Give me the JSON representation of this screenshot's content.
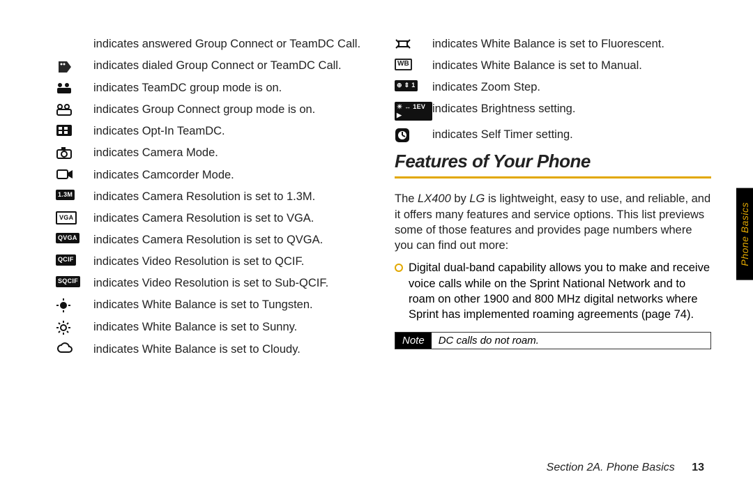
{
  "side_tab": "Phone Basics",
  "footer": {
    "section": "Section 2A. Phone Basics",
    "page": "13"
  },
  "heading": "Features of Your Phone",
  "intro": {
    "pre": "The ",
    "product": "LX400",
    "mid": " by ",
    "brand": "LG",
    "post": " is lightweight, easy to use, and reliable, and it offers many features and service options. This list previews some of those features and provides page numbers where you can find out more:"
  },
  "bullet": "Digital dual-band capability allows you to make and receive voice calls while on the Sprint National Network and to roam on other 1900 and 800 MHz digital networks where Sprint has implemented roaming agreements (page 74).",
  "note": {
    "label": "Note",
    "body": "DC calls do not roam."
  },
  "left_rows": [
    {
      "id": "answered-groupcall",
      "icon_svg": "",
      "text": "indicates answered Group Connect or TeamDC Call."
    },
    {
      "id": "dialed-groupcall",
      "icon_svg": "<svg width='26' height='22'><g fill='#111'><path d='M4 4 h12 l6 8 -6 8 h-12 z' opacity='0.9'/><circle cx='8' cy='8' r='1.5' fill='#fff'/><circle cx='12' cy='8' r='1.5' fill='#fff'/></g></svg>",
      "text": "indicates dialed Group Connect or TeamDC Call."
    },
    {
      "id": "teamdc-group-on",
      "icon_svg": "<svg width='24' height='20'><g fill='#111'><circle cx='6' cy='6' r='3'/><circle cx='16' cy='6' r='3'/><rect x='2' y='10' width='20' height='8' rx='2'/></g></svg>",
      "text": "indicates TeamDC group mode is on."
    },
    {
      "id": "groupconnect-on",
      "icon_svg": "<svg width='24' height='20'><g fill='none' stroke='#111' stroke-width='2'><circle cx='6' cy='6' r='3'/><circle cx='16' cy='6' r='3'/><rect x='2' y='10' width='20' height='8' rx='2'/></g></svg>",
      "text": "indicates Group Connect group mode is on."
    },
    {
      "id": "optin-teamdc",
      "icon_svg": "<svg width='24' height='18'><rect x='1' y='1' width='22' height='16' rx='2' fill='#111'/><rect x='4' y='4' width='5' height='4' fill='#fff'/><rect x='12' y='4' width='5' height='4' fill='#fff'/><rect x='4' y='10' width='5' height='4' fill='#fff'/><rect x='12' y='10' width='5' height='4' fill='#fff'/></svg>",
      "text": "indicates Opt-In TeamDC."
    },
    {
      "id": "camera-mode",
      "icon_svg": "<svg width='24' height='20'><rect x='2' y='6' width='20' height='12' rx='2' fill='none' stroke='#111' stroke-width='2'/><circle cx='12' cy='12' r='4' fill='none' stroke='#111' stroke-width='2'/><rect x='8' y='2' width='6' height='4' fill='#111'/></svg>",
      "text": "indicates Camera Mode."
    },
    {
      "id": "camcorder-mode",
      "icon_svg": "<svg width='26' height='18'><rect x='2' y='3' width='15' height='12' rx='2' fill='none' stroke='#111' stroke-width='2'/><path d='M17 7 l7 -4 v12 l-7 -4 z' fill='#111'/></svg>",
      "text": "indicates Camcorder Mode."
    },
    {
      "id": "res-1-3m",
      "icon_svg": "<span class='box-icon'>1.3M</span>",
      "text": "indicates Camera Resolution is set to 1.3M."
    },
    {
      "id": "res-vga",
      "icon_svg": "<span class='box-icon' style='background:#fff;color:#111;border:2px solid #111'>VGA</span>",
      "text": "indicates Camera Resolution is set to VGA."
    },
    {
      "id": "res-qvga",
      "icon_svg": "<span class='box-icon'>QVGA</span>",
      "text": "indicates Camera Resolution is set to QVGA."
    },
    {
      "id": "vidres-qcif",
      "icon_svg": "<span class='box-icon'>QCIF</span>",
      "text": "indicates Video Resolution is set to QCIF."
    },
    {
      "id": "vidres-subqcif",
      "icon_svg": "<span class='box-icon'>SQCIF</span>",
      "text": "indicates Video Resolution is set to Sub-QCIF."
    },
    {
      "id": "wb-tungsten",
      "icon_svg": "<svg width='22' height='22'><g fill='#111'><circle cx='11' cy='11' r='5'/><g stroke='#111' stroke-width='2'><line x1='11' y1='1' x2='11' y2='4'/><line x1='11' y1='18' x2='11' y2='21'/><line x1='1' y1='11' x2='4' y2='11'/><line x1='18' y1='11' x2='21' y2='11'/></g></g></svg>",
      "text": "indicates White Balance is set to Tungsten."
    },
    {
      "id": "wb-sunny",
      "icon_svg": "<svg width='22' height='22'><g fill='none' stroke='#111' stroke-width='2'><circle cx='11' cy='11' r='4'/><line x1='11' y1='1' x2='11' y2='4'/><line x1='11' y1='18' x2='11' y2='21'/><line x1='1' y1='11' x2='4' y2='11'/><line x1='18' y1='11' x2='21' y2='11'/><line x1='4' y1='4' x2='6' y2='6'/><line x1='16' y1='16' x2='18' y2='18'/><line x1='16' y1='6' x2='18' y2='4'/><line x1='4' y1='18' x2='6' y2='16'/></g></svg>",
      "text": "indicates White Balance is set to Sunny."
    },
    {
      "id": "wb-cloudy",
      "icon_svg": "<svg width='26' height='18'><path d='M8 14 a5 5 0 0 1 0 -10 a6 6 0 0 1 11 2 a4 4 0 0 1 0 8 z' fill='none' stroke='#111' stroke-width='2'/></svg>",
      "text": "indicates White Balance is set to Cloudy."
    }
  ],
  "right_rows": [
    {
      "id": "wb-fluorescent",
      "icon_svg": "<svg width='24' height='20'><g stroke='#111' stroke-width='2'><rect x='6' y='6' width='12' height='8' fill='none'/><line x1='2' y1='4' x2='6' y2='8'/><line x1='22' y1='4' x2='18' y2='8'/><line x1='2' y1='16' x2='6' y2='12'/><line x1='22' y1='16' x2='18' y2='12'/></g></svg>",
      "text": "indicates White Balance is set to Fluorescent."
    },
    {
      "id": "wb-manual",
      "icon_svg": "<span class='wb-box'>WB</span>",
      "text": "indicates White Balance is set to Manual."
    },
    {
      "id": "zoom-step",
      "icon_svg": "<span class='box-icon'>⊕ ⇕ 1</span>",
      "text": "indicates Zoom Step."
    },
    {
      "id": "brightness",
      "icon_svg": "<span class='box-icon'>☀ ↔ 1EV ▶</span>",
      "text": "indicates Brightness setting."
    },
    {
      "id": "self-timer",
      "icon_svg": "<svg width='22' height='22'><rect x='1' y='1' width='20' height='20' rx='5' fill='#111'/><circle cx='11' cy='11' r='6' fill='#fff'/><path d='M11 11 L11 6 M11 11 L15 13' stroke='#111' stroke-width='2'/></svg>",
      "text": "indicates Self Timer setting."
    }
  ]
}
